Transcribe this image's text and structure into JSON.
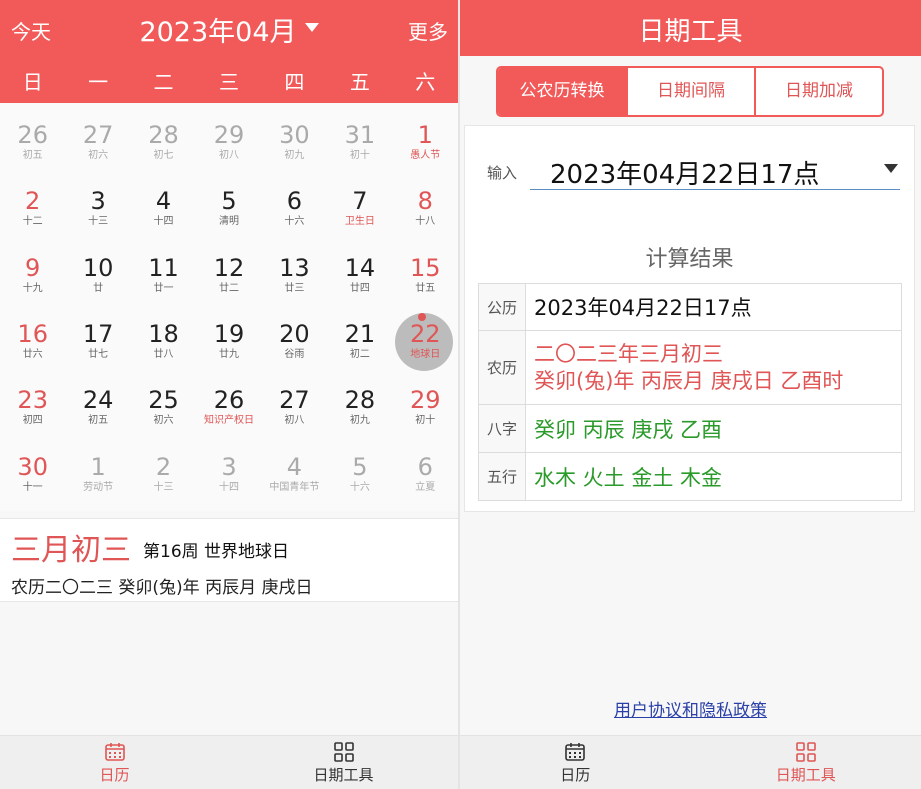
{
  "left": {
    "header": {
      "today": "今天",
      "month": "2023年04月",
      "more": "更多"
    },
    "weekdays": [
      "日",
      "一",
      "二",
      "三",
      "四",
      "五",
      "六"
    ],
    "days": [
      {
        "n": "26",
        "l": "初五",
        "dim": true
      },
      {
        "n": "27",
        "l": "初六",
        "dim": true
      },
      {
        "n": "28",
        "l": "初七",
        "dim": true
      },
      {
        "n": "29",
        "l": "初八",
        "dim": true
      },
      {
        "n": "30",
        "l": "初九",
        "dim": true
      },
      {
        "n": "31",
        "l": "初十",
        "dim": true
      },
      {
        "n": "1",
        "l": "愚人节",
        "fest": true
      },
      {
        "n": "2",
        "l": "十二"
      },
      {
        "n": "3",
        "l": "十三"
      },
      {
        "n": "4",
        "l": "十四"
      },
      {
        "n": "5",
        "l": "清明"
      },
      {
        "n": "6",
        "l": "十六"
      },
      {
        "n": "7",
        "l": "卫生日",
        "fest": true
      },
      {
        "n": "8",
        "l": "十八"
      },
      {
        "n": "9",
        "l": "十九"
      },
      {
        "n": "10",
        "l": "廿"
      },
      {
        "n": "11",
        "l": "廿一"
      },
      {
        "n": "12",
        "l": "廿二"
      },
      {
        "n": "13",
        "l": "廿三"
      },
      {
        "n": "14",
        "l": "廿四"
      },
      {
        "n": "15",
        "l": "廿五"
      },
      {
        "n": "16",
        "l": "廿六"
      },
      {
        "n": "17",
        "l": "廿七"
      },
      {
        "n": "18",
        "l": "廿八"
      },
      {
        "n": "19",
        "l": "廿九"
      },
      {
        "n": "20",
        "l": "谷雨"
      },
      {
        "n": "21",
        "l": "初二"
      },
      {
        "n": "22",
        "l": "地球日",
        "selected": true
      },
      {
        "n": "23",
        "l": "初四"
      },
      {
        "n": "24",
        "l": "初五"
      },
      {
        "n": "25",
        "l": "初六"
      },
      {
        "n": "26",
        "l": "知识产权日",
        "fest": true
      },
      {
        "n": "27",
        "l": "初八"
      },
      {
        "n": "28",
        "l": "初九"
      },
      {
        "n": "29",
        "l": "初十"
      },
      {
        "n": "30",
        "l": "十一"
      },
      {
        "n": "1",
        "l": "劳动节",
        "dim": true
      },
      {
        "n": "2",
        "l": "十三",
        "dim": true
      },
      {
        "n": "3",
        "l": "十四",
        "dim": true
      },
      {
        "n": "4",
        "l": "中国青年节",
        "dim": true
      },
      {
        "n": "5",
        "l": "十六",
        "dim": true
      },
      {
        "n": "6",
        "l": "立夏",
        "dim": true
      }
    ],
    "info": {
      "big": "三月初三",
      "week": "第16周 世界地球日",
      "lunar": "农历二〇二三 癸卯(兔)年 丙辰月 庚戌日"
    },
    "tabs": [
      {
        "label": "日历",
        "active": true
      },
      {
        "label": "日期工具",
        "active": false
      }
    ]
  },
  "right": {
    "header": {
      "title": "日期工具"
    },
    "segments": [
      "公农历转换",
      "日期间隔",
      "日期加减"
    ],
    "input": {
      "label": "输入",
      "value": "2023年04月22日17点"
    },
    "result_title": "计算结果",
    "rows": {
      "gongli": {
        "k": "公历",
        "v": "2023年04月22日17点"
      },
      "nongli": {
        "k": "农历",
        "v1": "二〇二三年三月初三",
        "v2": "癸卯(兔)年 丙辰月 庚戌日 乙酉时"
      },
      "bazi": {
        "k": "八字",
        "v": "癸卯 丙辰 庚戌 乙酉"
      },
      "wuxing": {
        "k": "五行",
        "v": "水木 火土 金土 木金"
      }
    },
    "privacy": "用户协议和隐私政策",
    "tabs": [
      {
        "label": "日历",
        "active": false
      },
      {
        "label": "日期工具",
        "active": true
      }
    ]
  },
  "colors": {
    "accent": "#f25a5a",
    "festival": "#e05555",
    "ganzhi": "#2a9a2a",
    "link": "#2a40a8"
  }
}
